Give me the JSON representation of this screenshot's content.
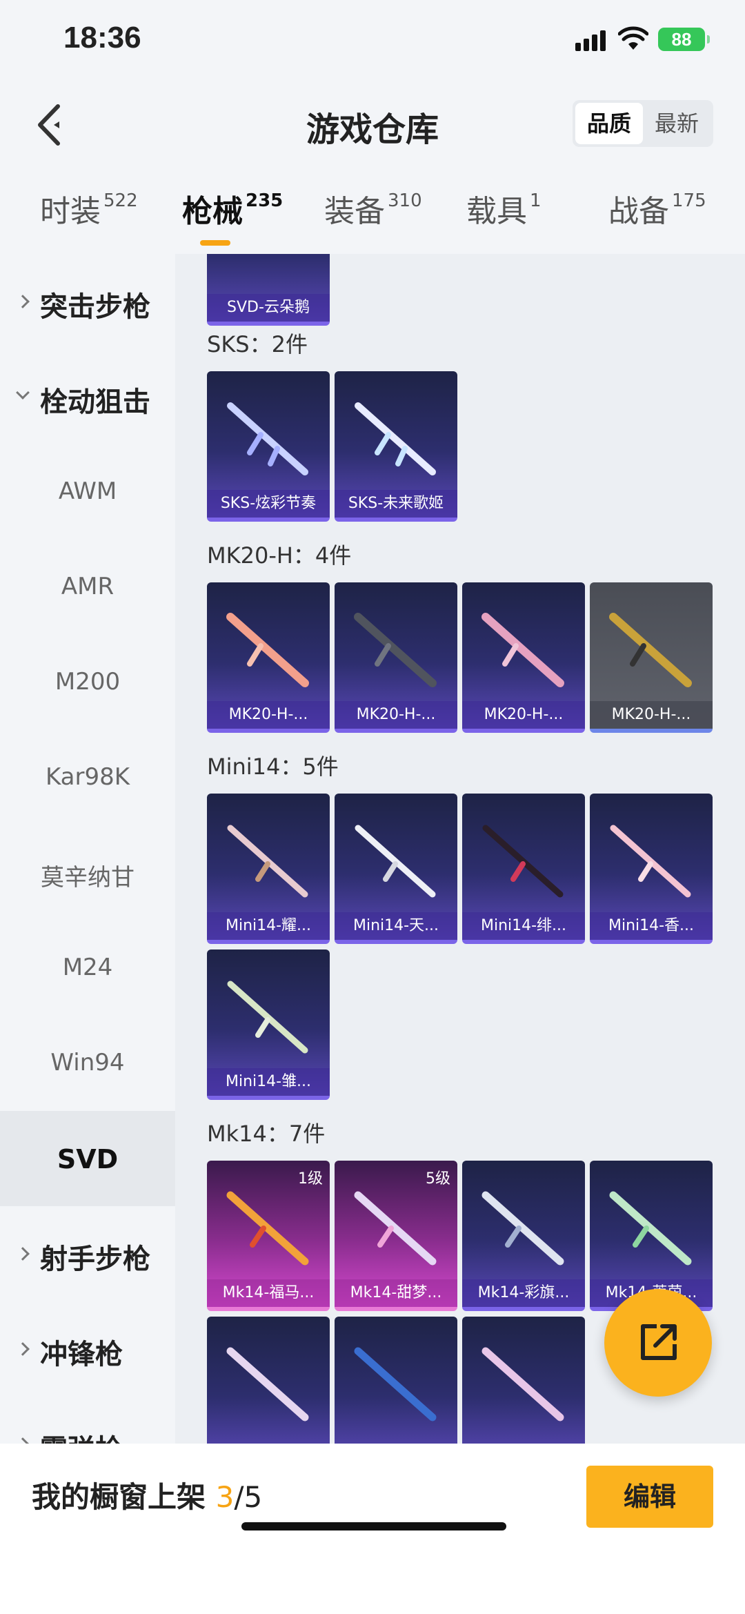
{
  "status": {
    "time": "18:36",
    "battery": "88"
  },
  "header": {
    "title": "游戏仓库",
    "sort": [
      "品质",
      "最新"
    ]
  },
  "tabs": [
    {
      "label": "时装",
      "count": "522"
    },
    {
      "label": "枪械",
      "count": "235"
    },
    {
      "label": "装备",
      "count": "310"
    },
    {
      "label": "载具",
      "count": "1"
    },
    {
      "label": "战备",
      "count": "175"
    }
  ],
  "sidebar": [
    {
      "label": "突击步枪"
    },
    {
      "label": "栓动狙击"
    },
    {
      "label": "AWM"
    },
    {
      "label": "AMR"
    },
    {
      "label": "M200"
    },
    {
      "label": "Kar98K"
    },
    {
      "label": "莫辛纳甘"
    },
    {
      "label": "M24"
    },
    {
      "label": "Win94"
    },
    {
      "label": "SVD"
    },
    {
      "label": "射手步枪"
    },
    {
      "label": "冲锋枪"
    },
    {
      "label": "霰弹枪"
    }
  ],
  "content": {
    "svd": {
      "items": [
        "SVD-云朵鹅"
      ]
    },
    "sks": {
      "title": "SKS：2件",
      "items": [
        "SKS-炫彩节奏",
        "SKS-未来歌姬"
      ]
    },
    "mk20": {
      "title": "MK20-H：4件",
      "items": [
        "MK20-H-...",
        "MK20-H-...",
        "MK20-H-...",
        "MK20-H-..."
      ]
    },
    "mini14": {
      "title": "Mini14：5件",
      "items": [
        "Mini14-耀...",
        "Mini14-天...",
        "Mini14-绯...",
        "Mini14-香...",
        "Mini14-雏..."
      ]
    },
    "mk14": {
      "title": "Mk14：7件",
      "items": [
        "Mk14-福马...",
        "Mk14-甜梦...",
        "Mk14-彩旗...",
        "Mk14-莱茵..."
      ],
      "levels": [
        "1级",
        "5级"
      ]
    }
  },
  "bottom": {
    "shelf_label": "我的橱窗上架 ",
    "shelf_count": "3",
    "shelf_total": "/5",
    "edit": "编辑"
  },
  "colors": {
    "accent": "#f7a414",
    "fab": "#fbb21e",
    "card": "#2d2e6e"
  }
}
